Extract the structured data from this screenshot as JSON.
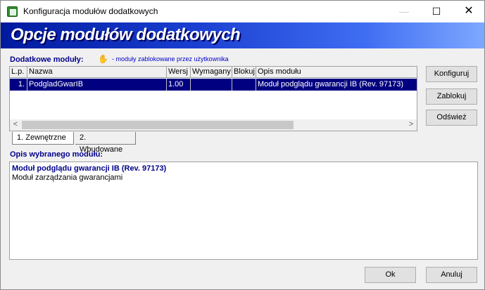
{
  "window": {
    "title": "Konfiguracja modułów dodatkowych",
    "minimize_glyph": "—",
    "maximize_glyph": "☐",
    "close_glyph": "✕"
  },
  "banner": {
    "text": "Opcje modułów dodatkowych"
  },
  "modules_section": {
    "label": "Dodatkowe moduły:",
    "hint_icon": "hand-icon",
    "hint": "- moduły zablokowane przez użytkownika"
  },
  "grid": {
    "columns": [
      "L.p.",
      "Nazwa",
      "Wersj",
      "Wymagany",
      "Blokuj",
      "Opis modułu"
    ],
    "rows": [
      {
        "lp": "1.",
        "name": "PodgladGwarIB",
        "version": "1.00",
        "required": "",
        "block": "",
        "description": "Moduł podglądu gwarancji IB (Rev. 97173)"
      }
    ],
    "scroll_left": "<",
    "scroll_right": ">"
  },
  "tabs": [
    {
      "label": "1. Zewnętrzne"
    },
    {
      "label": "2. Wbudowane"
    }
  ],
  "description_section": {
    "label": "Opis wybranego modułu:",
    "title": "Moduł podglądu gwarancji IB (Rev. 97173)",
    "body": "Moduł zarządzania gwarancjami"
  },
  "buttons": {
    "configure": "Konfiguruj",
    "block": "Zablokuj",
    "refresh": "Odśwież",
    "ok": "Ok",
    "cancel": "Anuluj"
  },
  "colors": {
    "selection": "#000080",
    "section_label": "#00008b",
    "hint": "#0000c8",
    "banner_start": "#001a9e",
    "banner_end": "#7ea8ff"
  }
}
